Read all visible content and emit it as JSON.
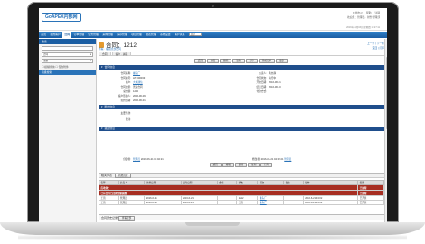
{
  "app": {
    "logo_text": "GoAPEX内部网",
    "top_links": [
      "在线办公",
      "帮助",
      "注销"
    ],
    "user_info": "欢迎您：管理员 · 财务管理部",
    "time": "2016年11月03日 星期四 10:27:11"
  },
  "nav": {
    "items": [
      "首页",
      "我的客户",
      "合同",
      "订单管理",
      "任务管理",
      "采购管理",
      "库存管理",
      "项目管理",
      "报表管理",
      "系统设置",
      "客户关系"
    ],
    "active_index": 2,
    "select_value": "全部"
  },
  "sidebar": {
    "header": "搜索",
    "search_value": "",
    "filter_value": "合同",
    "field_value": "主题",
    "option1": "模糊查询",
    "option2": "包含附件",
    "link": "高级搜索"
  },
  "record": {
    "title": "合同：1212",
    "subtitle": "查看 · 编辑全部合同",
    "links": [
      "上一条 | 下一条",
      "返回 | 打印"
    ],
    "tabs": [
      "合同",
      "客户 · 关联"
    ]
  },
  "actions_top": [
    "返回",
    "编辑",
    "删除",
    "复制",
    "打印",
    "转成订单",
    "更多"
  ],
  "sections": {
    "basic": "合同信息",
    "detail": "附加信息",
    "desc": "描述信息"
  },
  "fields_left": [
    {
      "label": "合同名称:",
      "value": "罐头厂",
      "link": true
    },
    {
      "label": "合同编号:",
      "value": "HT-000033",
      "link": false
    },
    {
      "label": "客户:",
      "value": "大地通信",
      "link": true
    },
    {
      "label": "合同类型:",
      "value": "普通合同",
      "link": false
    },
    {
      "label": "总金额:",
      "value": "1212",
      "link": false
    },
    {
      "label": "客户签约人:",
      "value": "2016-06-09",
      "link": false
    },
    {
      "label": "签约日期:",
      "value": "2016-06-01",
      "link": false
    }
  ],
  "fields_right": [
    {
      "label": "负责人:",
      "value": "黄文静",
      "link": false
    },
    {
      "label": "合同状态:",
      "value": "执行中",
      "link": false
    },
    {
      "label": "开始日期:",
      "value": "2016-06-01",
      "link": false
    },
    {
      "label": "结束日期:",
      "value": "2016-06-30",
      "link": false
    },
    {
      "label": "付款方式:",
      "value": "",
      "link": false
    }
  ],
  "detail_fields": [
    {
      "label": "主要条款:",
      "value": ""
    },
    {
      "label": "备注:",
      "value": ""
    }
  ],
  "meta": {
    "creator_label": "创建者:",
    "creator": "管理员",
    "created": "2016-06-21 04:02:21",
    "modifier_label": "修改者:",
    "modified": "2016-06-21 04:02:21",
    "modifier": "管理员"
  },
  "actions_bottom": [
    "返回",
    "编辑",
    "删除",
    "复制",
    "打印"
  ],
  "related": {
    "title": "相关列表",
    "button": "新增回款",
    "columns": [
      "名称",
      "负责人",
      "计划日期",
      "实际日期",
      "金额",
      "状态",
      "期次",
      "备注",
      "操作",
      "提醒"
    ],
    "warn_rows": [
      "应收款：",
      "已有合同已回款金额提醒"
    ],
    "rows": [
      [
        "王营",
        "管理员",
        "2016-6-21",
        "2016-6-21",
        "",
        "1212",
        "罐头厂",
        "",
        "2016-6-21 04:02",
        "已开票"
      ],
      [
        "王营",
        "管理员",
        "2016-6-21",
        "2016-6-21",
        "",
        "王营",
        "罐头厂",
        "",
        "2016-6-21 04:02",
        "已开票"
      ]
    ],
    "ok_label": "已处理"
  },
  "history": {
    "title": "合同历史记录",
    "button": "查看全部"
  }
}
